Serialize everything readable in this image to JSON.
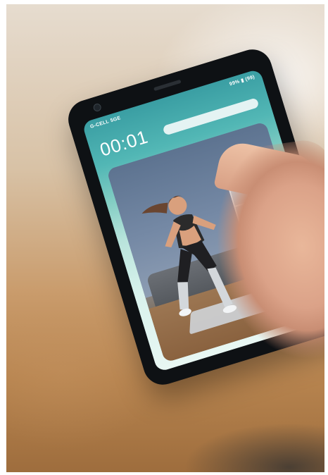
{
  "phone": {
    "carrier": "G-CELL 5GE",
    "battery": "99% ▮ (99)",
    "timer": "00:01"
  },
  "colors": {
    "screen_top": "#3a9ea3",
    "screen_mid": "#82cdc3",
    "screen_bottom": "#e8f7f3",
    "phone_body": "#0e1114",
    "background_warm": "#c99b6b"
  }
}
